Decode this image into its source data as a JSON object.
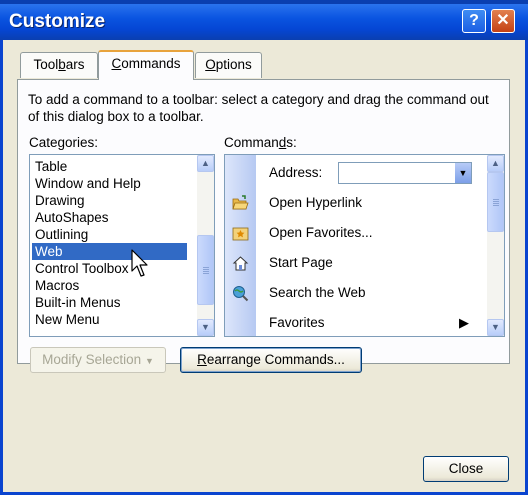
{
  "window": {
    "title": "Customize"
  },
  "tabs": [
    {
      "label_pre": "Tool",
      "label_u": "b",
      "label_post": "ars"
    },
    {
      "label_pre": "",
      "label_u": "C",
      "label_post": "ommands"
    },
    {
      "label_pre": "",
      "label_u": "O",
      "label_post": "ptions"
    }
  ],
  "instructions": "To add a command to a toolbar: select a category and drag the command out of this dialog box to a toolbar.",
  "categories_label": {
    "pre": "Cate",
    "u": "g",
    "post": "ories:"
  },
  "commands_label": {
    "pre": "Comman",
    "u": "d",
    "post": "s:"
  },
  "categories": [
    "Table",
    "Window and Help",
    "Drawing",
    "AutoShapes",
    "Outlining",
    "Web",
    "Control Toolbox",
    "Macros",
    "Built-in Menus",
    "New Menu"
  ],
  "selected_category": "Web",
  "commands": [
    {
      "label": "Address:",
      "icon": "none"
    },
    {
      "label": "Open Hyperlink",
      "icon": "open-folder-icon"
    },
    {
      "label": "Open Favorites...",
      "icon": "favorites-folder-icon"
    },
    {
      "label": "Start Page",
      "icon": "home-icon"
    },
    {
      "label": "Search the Web",
      "icon": "search-globe-icon"
    },
    {
      "label": "Favorites",
      "icon": "none"
    }
  ],
  "buttons": {
    "modify_selection": "Modify Selection",
    "rearrange": {
      "pre": "",
      "u": "R",
      "post": "earrange Commands..."
    },
    "close": "Close"
  }
}
